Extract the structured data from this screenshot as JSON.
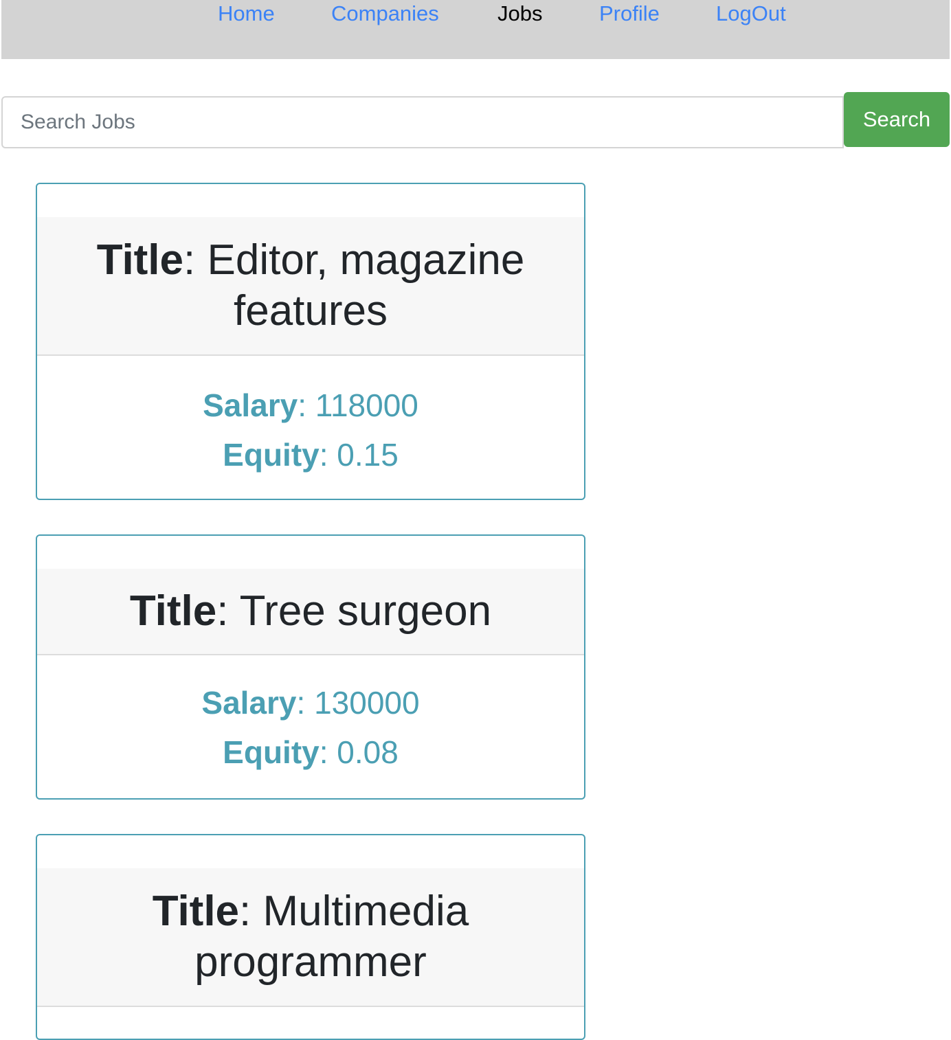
{
  "nav": {
    "home": "Home",
    "companies": "Companies",
    "jobs": "Jobs",
    "profile": "Profile",
    "logout": "LogOut"
  },
  "search": {
    "placeholder": "Search Jobs",
    "value": "",
    "button_label": "Search"
  },
  "labels": {
    "title": "Title",
    "salary": "Salary",
    "equity": "Equity",
    "separator": ": "
  },
  "jobs": [
    {
      "title": "Editor, magazine features",
      "salary": "118000",
      "equity": "0.15"
    },
    {
      "title": "Tree surgeon",
      "salary": "130000",
      "equity": "0.08"
    },
    {
      "title": "Multimedia programmer",
      "salary": "",
      "equity": ""
    }
  ],
  "colors": {
    "navbar_bg": "#d3d3d3",
    "link": "#3b82f6",
    "active_link": "#000000",
    "search_button": "#52a653",
    "card_border": "#4b9fb3",
    "card_accent": "#4b9fb3"
  }
}
